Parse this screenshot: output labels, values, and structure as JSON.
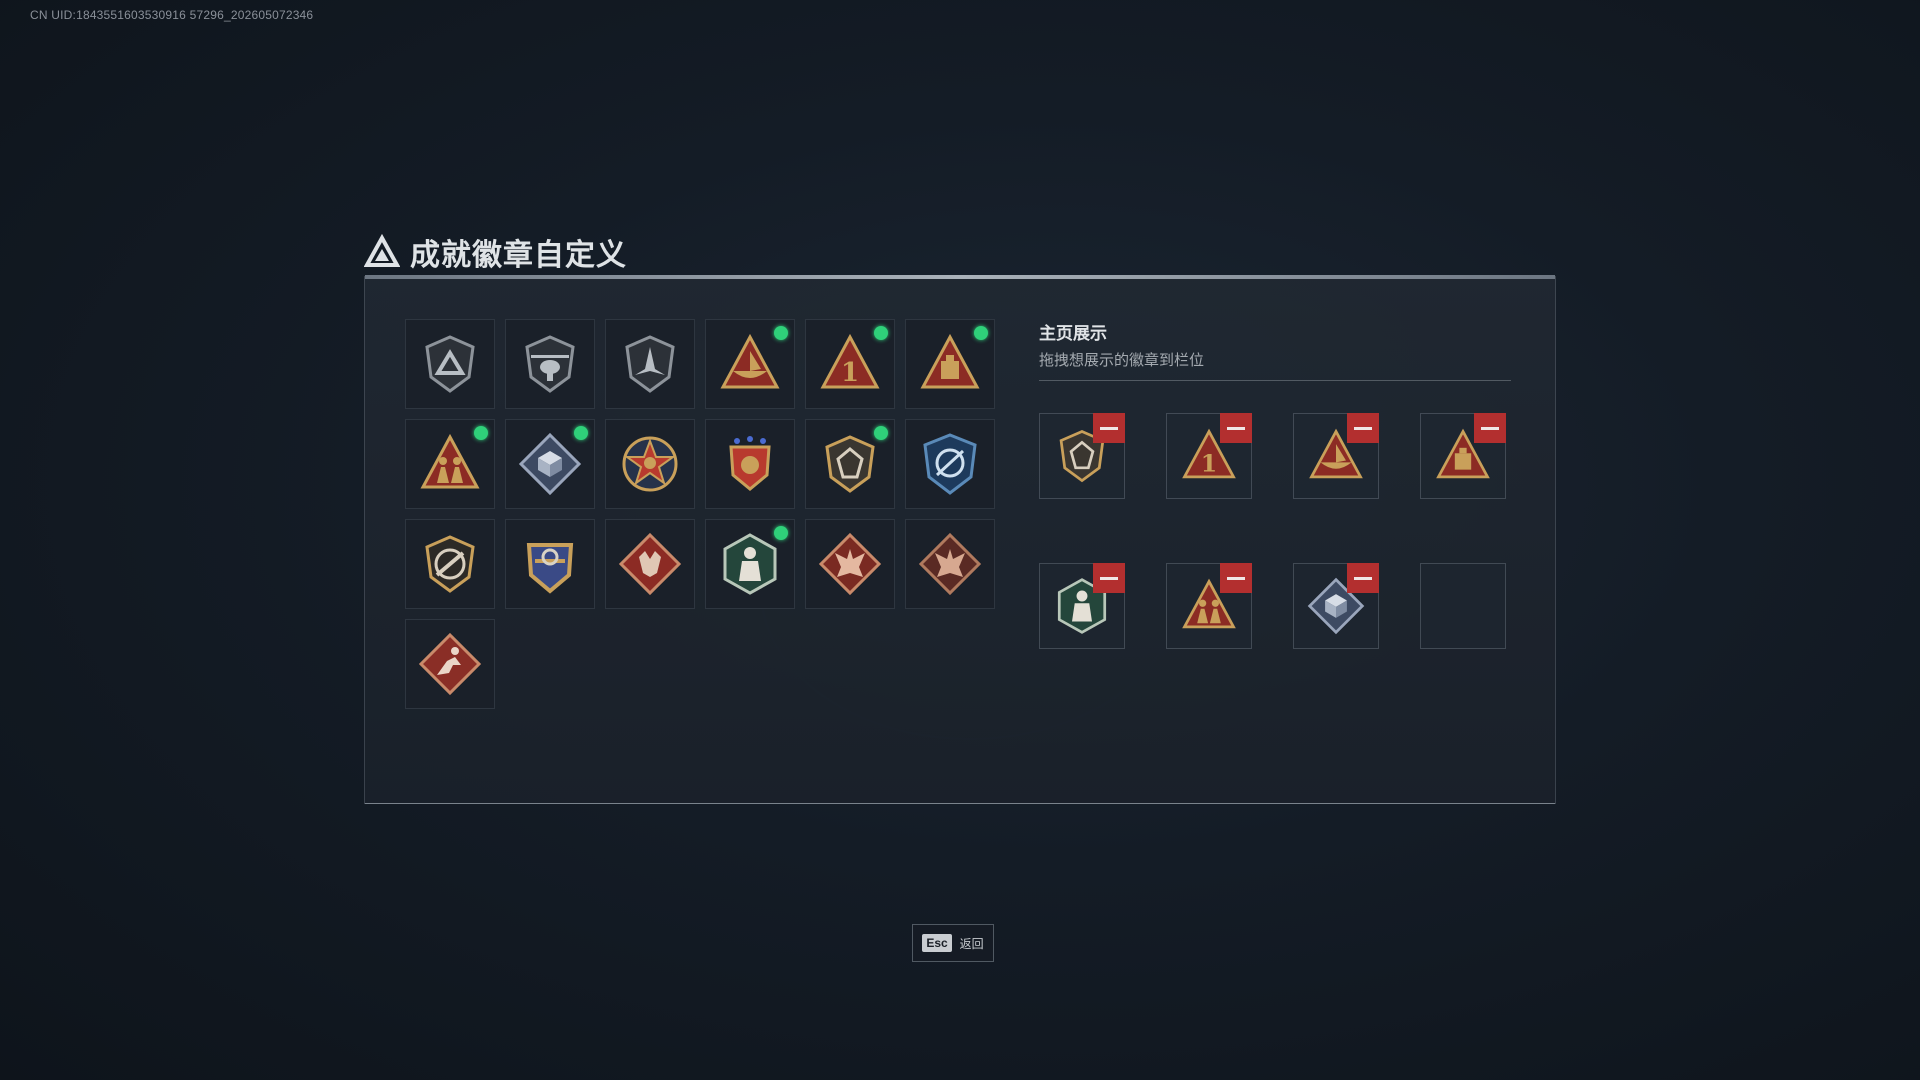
{
  "header": {
    "uid": "CN UID:1843551603530916 57296_202605072346"
  },
  "title": "成就徽章自定义",
  "badges": [
    {
      "icon": "delta-shield-badge-icon",
      "new": false
    },
    {
      "icon": "helicopter-badge-icon",
      "new": false
    },
    {
      "icon": "jet-shield-badge-icon",
      "new": false
    },
    {
      "icon": "boat-triangle-badge-icon",
      "new": true
    },
    {
      "icon": "number-one-triangle-badge-icon",
      "new": true
    },
    {
      "icon": "crate-triangle-badge-icon",
      "new": true
    },
    {
      "icon": "soldiers-triangle-badge-icon",
      "new": true
    },
    {
      "icon": "diamond-cube-badge-icon",
      "new": true
    },
    {
      "icon": "star-medal-badge-icon",
      "new": false
    },
    {
      "icon": "crest-stars-badge-icon",
      "new": false
    },
    {
      "icon": "gem-shield-badge-icon",
      "new": true
    },
    {
      "icon": "blue-target-shield-badge-icon",
      "new": false
    },
    {
      "icon": "rifle-shield-badge-icon",
      "new": false
    },
    {
      "icon": "gold-crest-badge-icon",
      "new": false
    },
    {
      "icon": "wolf-diamond-badge-icon",
      "new": false
    },
    {
      "icon": "fighter-hexagon-badge-icon",
      "new": true
    },
    {
      "icon": "dragon-red-badge-icon",
      "new": false
    },
    {
      "icon": "dragon-dark-badge-icon",
      "new": false
    },
    {
      "icon": "runner-diamond-badge-icon",
      "new": false
    }
  ],
  "showcase": {
    "title": "主页展示",
    "subtitle": "拖拽想展示的徽章到栏位",
    "slots": [
      {
        "icon": "gem-shield-badge-icon",
        "filled": true
      },
      {
        "icon": "number-one-triangle-badge-icon",
        "filled": true
      },
      {
        "icon": "boat-triangle-badge-icon",
        "filled": true
      },
      {
        "icon": "crate-triangle-badge-icon",
        "filled": true
      },
      {
        "icon": "fighter-hexagon-badge-icon",
        "filled": true
      },
      {
        "icon": "soldiers-triangle-badge-icon",
        "filled": true
      },
      {
        "icon": "diamond-cube-badge-icon",
        "filled": true
      },
      {
        "icon": "",
        "filled": false
      }
    ]
  },
  "footer": {
    "key": "Esc",
    "label": "返回"
  },
  "colors": {
    "new_dot": "#2fd17a",
    "remove": "#b32f2f",
    "gold": "#c9a05a",
    "red": "#8c2b24"
  }
}
